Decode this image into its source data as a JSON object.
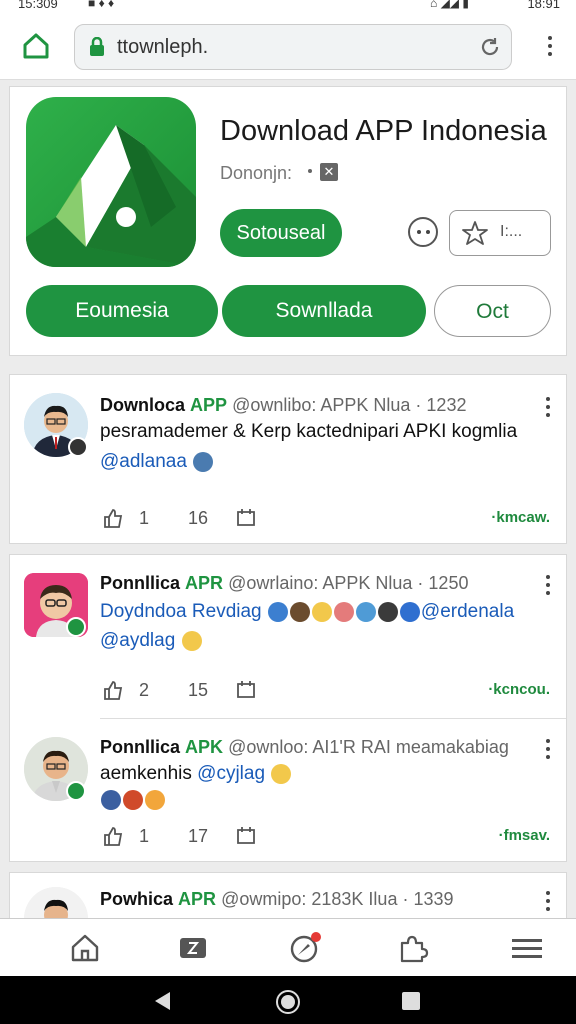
{
  "status": {
    "time": "15:309",
    "clock_right": "18:91"
  },
  "browser": {
    "url": "ttownleph.",
    "home_icon": "home-icon",
    "lock_icon": "lock-icon",
    "reload_icon": "reload-icon"
  },
  "app": {
    "title": "Download APP Indonesia",
    "subtitle": "Dononjn:",
    "primary_button": "Sotouseal",
    "wishlist_label": "I:...",
    "pills": [
      "Eoumesia",
      "Sownllada",
      "Oct"
    ]
  },
  "posts": [
    {
      "name": "Downloca",
      "tag": "APP",
      "meta": "@ownlibo: APPK Nlua · 1232",
      "body": "pesramademer & Kerp kactednipari APKI kogmlia",
      "mention": "@adlanaa",
      "likes": "1",
      "comments": "16",
      "source": "·kmcaw."
    },
    {
      "name": "Ponnllica",
      "tag": "APR",
      "meta": "@owrlaino: APPK Nlua · 1250",
      "body": "Doydndoa Revdiag",
      "body_mention": "@erdenala",
      "mention": "@aydlag",
      "likes": "2",
      "comments": "15",
      "source": "·kcncou."
    },
    {
      "name": "Ponnllica",
      "tag": "APK",
      "meta": "@ownloo: AI1'R RAI meamakabiag",
      "body": "aemkenhis",
      "mention": "@cyjlag",
      "likes": "1",
      "comments": "17",
      "source": "·fmsav."
    },
    {
      "name": "Powhica",
      "tag": "APR",
      "meta": "@owmipo: 2183K Ilua · 1339"
    }
  ],
  "colors": {
    "accent": "#1f9441",
    "link": "#1a5bb8"
  }
}
